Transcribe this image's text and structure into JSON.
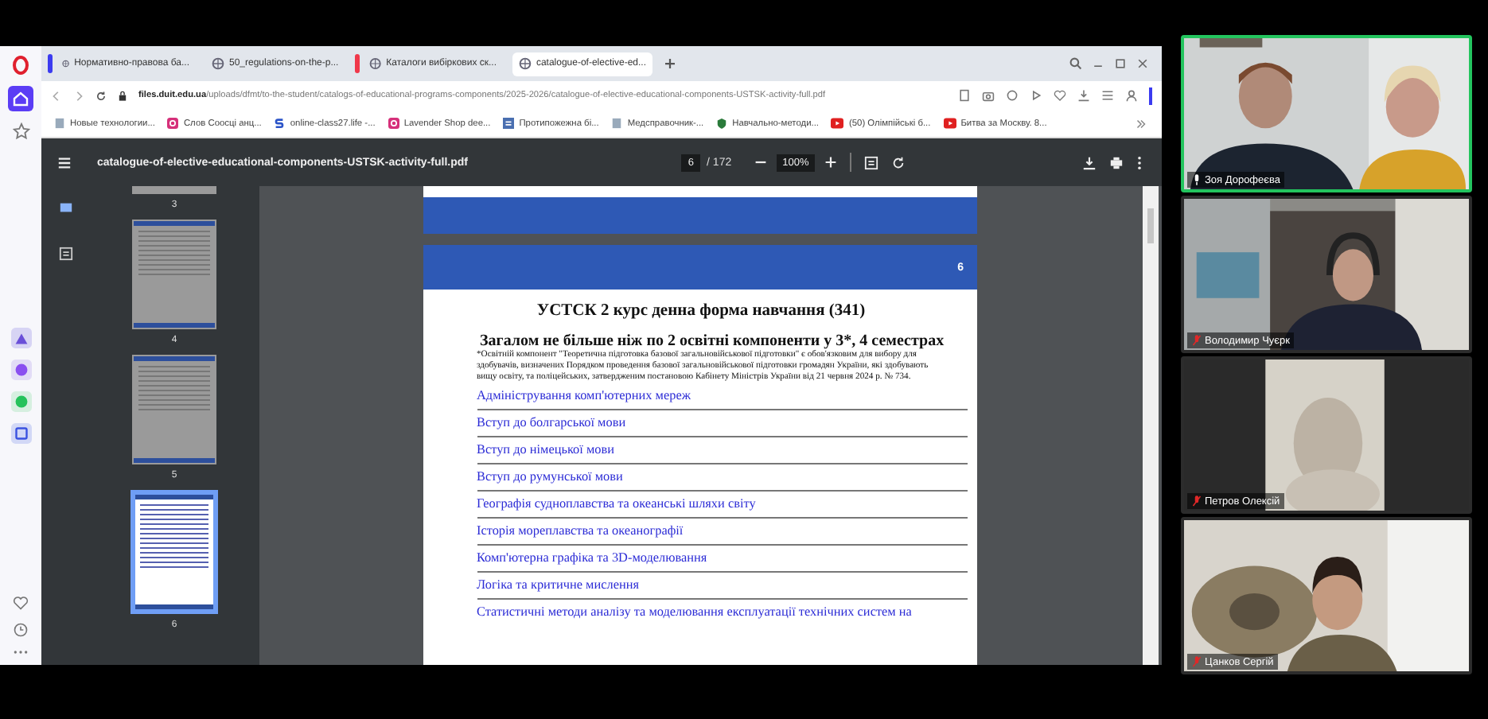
{
  "browser": {
    "tabs": [
      {
        "title": "Нормативно-правова ба...",
        "selected": false,
        "color": "#3b3bf0"
      },
      {
        "title": "50_regulations-on-the-p...",
        "selected": false
      },
      {
        "title": "Каталоги вибіркових ск...",
        "selected": false,
        "color": "#f0384a"
      },
      {
        "title": "catalogue-of-elective-ed...",
        "selected": true
      }
    ],
    "url_host": "files.duit.edu.ua",
    "url_path": "/uploads/dfmt/to-the-student/catalogs-of-educational-programs-components/2025-2026/catalogue-of-elective-educational-components-USTSK-activity-full.pdf",
    "bookmarks": [
      {
        "title": "Новые технологии...",
        "kind": "page"
      },
      {
        "title": "Слов Соосці анц...",
        "kind": "insta"
      },
      {
        "title": "online-class27.life -...",
        "kind": "s"
      },
      {
        "title": "Lavender Shop dee...",
        "kind": "insta"
      },
      {
        "title": "Протипожежна бі...",
        "kind": "doc"
      },
      {
        "title": "Медсправочник-...",
        "kind": "page"
      },
      {
        "title": "Навчально-методи...",
        "kind": "shield"
      },
      {
        "title": "(50) Олімпійські б...",
        "kind": "youtube"
      },
      {
        "title": "Битва за Москву. 8...",
        "kind": "youtube"
      }
    ]
  },
  "pdf_viewer": {
    "file_name": "catalogue-of-elective-educational-components-USTSK-activity-full.pdf",
    "page_input": "6",
    "page_total": "/ 172",
    "zoom": "100%",
    "thumbnails": [
      {
        "label": "3",
        "selected": false
      },
      {
        "label": "4",
        "selected": false
      },
      {
        "label": "5",
        "selected": false
      },
      {
        "label": "6",
        "selected": true
      }
    ],
    "page_number": "6",
    "heading": "УСТСК 2 курс денна форма навчання (341)",
    "subheading": "Загалом не більше ніж по 2 освітні компоненти у 3*, 4 семестрах",
    "note": "*Освітній компонент \"Теоретична підготовка базової загальновійськової підготовки\" є обов'язковим для вибору для здобувачів, визначених Порядком проведення базової загальновійськової підготовки громадян України, які здобувають вищу освіту, та поліцейських, затвердженим постановою Кабінету Міністрів України від 21 червня 2024 р. № 734.",
    "components": [
      "Адміністрування комп'ютерних мереж",
      "Вступ до болгарської мови",
      "Вступ до німецької мови",
      "Вступ до румунської мови",
      "Географія судноплавства та океанські шляхи світу",
      "Історія мореплавства та океанографії",
      "Комп'ютерна графіка та 3D-моделювання",
      "Логіка та критичне мислення",
      "Статистичні методи аналізу та моделювання експлуатації технічних систем на"
    ]
  },
  "participants": [
    {
      "name": "Зоя Дорофеєва",
      "muted": false,
      "speaking": true
    },
    {
      "name": "Володимир Чуєрк",
      "muted": true,
      "speaking": false
    },
    {
      "name": "Петров Олексій",
      "muted": true,
      "speaking": false
    },
    {
      "name": "Цанков Сергій",
      "muted": true,
      "speaking": false
    }
  ]
}
